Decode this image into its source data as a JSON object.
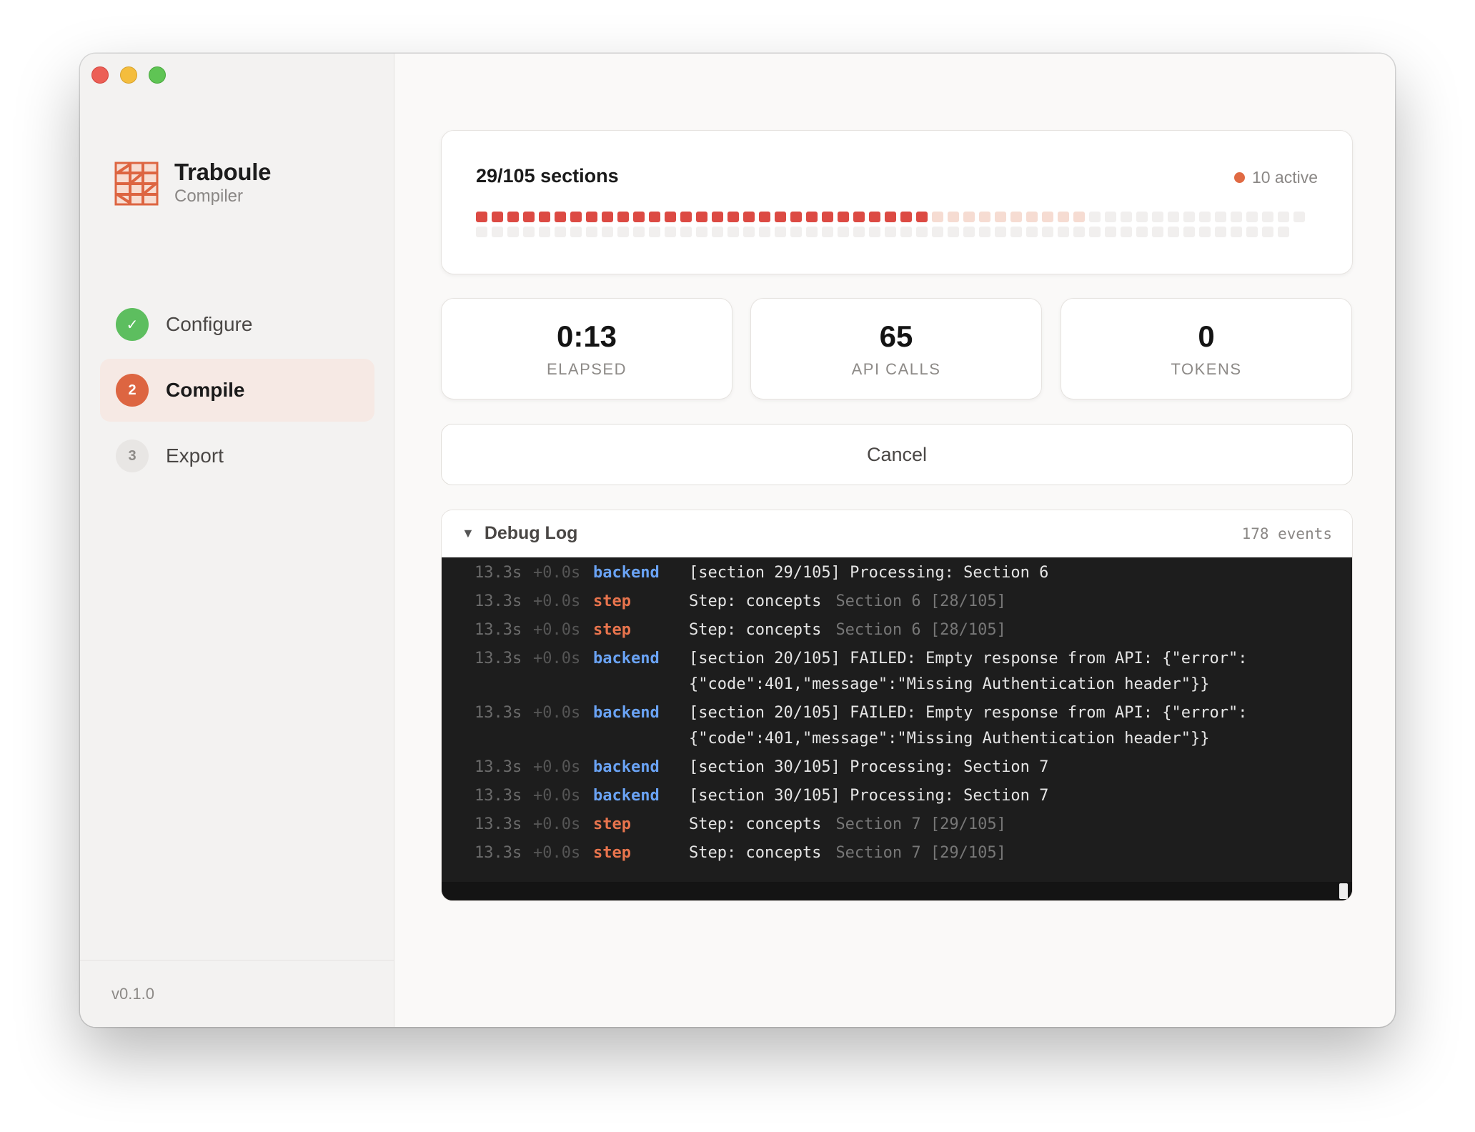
{
  "window": {
    "traffic_lights": [
      "close",
      "minimize",
      "maximize"
    ]
  },
  "brand": {
    "name": "Traboule",
    "subtitle": "Compiler",
    "logo_icon": "traboule-logo",
    "logo_color": "#dd6541"
  },
  "steps": [
    {
      "number": "✓",
      "label": "Configure",
      "state": "done"
    },
    {
      "number": "2",
      "label": "Compile",
      "state": "active"
    },
    {
      "number": "3",
      "label": "Export",
      "state": "pending"
    }
  ],
  "version": "v0.1.0",
  "progress": {
    "title": "29/105 sections",
    "active_label": "10 active",
    "total": 105,
    "done": 29,
    "active": 10,
    "colors": {
      "done": "#dc4a43",
      "active": "#f6dcd2",
      "pending": "#f1efee"
    }
  },
  "stats": [
    {
      "value": "0:13",
      "label": "ELAPSED"
    },
    {
      "value": "65",
      "label": "API CALLS"
    },
    {
      "value": "0",
      "label": "TOKENS"
    }
  ],
  "cancel_label": "Cancel",
  "log": {
    "title": "Debug Log",
    "count": "178 events",
    "caret": "▼",
    "entries": [
      {
        "time": "13.3s",
        "delta": "+0.0s",
        "source": "backend",
        "message": "[section 29/105] Processing: Section 6",
        "extra": ""
      },
      {
        "time": "13.3s",
        "delta": "+0.0s",
        "source": "step",
        "message": "Step: concepts",
        "extra": "Section 6 [28/105]"
      },
      {
        "time": "13.3s",
        "delta": "+0.0s",
        "source": "step",
        "message": "Step: concepts",
        "extra": "Section 6 [28/105]"
      },
      {
        "time": "13.3s",
        "delta": "+0.0s",
        "source": "backend",
        "message": "[section 20/105] FAILED: Empty response from API: {\"error\":\n{\"code\":401,\"message\":\"Missing Authentication header\"}}",
        "extra": ""
      },
      {
        "time": "13.3s",
        "delta": "+0.0s",
        "source": "backend",
        "message": "[section 20/105] FAILED: Empty response from API: {\"error\":\n{\"code\":401,\"message\":\"Missing Authentication header\"}}",
        "extra": ""
      },
      {
        "time": "13.3s",
        "delta": "+0.0s",
        "source": "backend",
        "message": "[section 30/105] Processing: Section 7",
        "extra": ""
      },
      {
        "time": "13.3s",
        "delta": "+0.0s",
        "source": "backend",
        "message": "[section 30/105] Processing: Section 7",
        "extra": ""
      },
      {
        "time": "13.3s",
        "delta": "+0.0s",
        "source": "step",
        "message": "Step: concepts",
        "extra": "Section 7 [29/105]"
      },
      {
        "time": "13.3s",
        "delta": "+0.0s",
        "source": "step",
        "message": "Step: concepts",
        "extra": "Section 7 [29/105]"
      }
    ]
  }
}
